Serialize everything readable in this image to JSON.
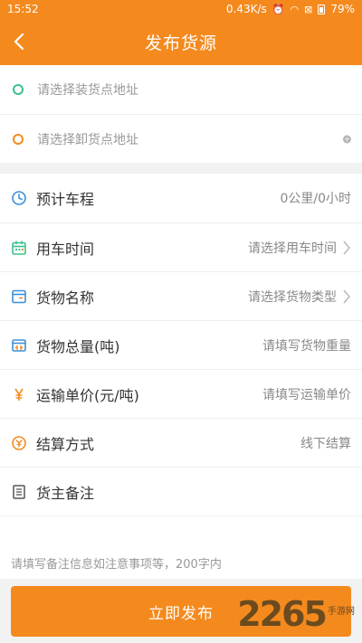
{
  "status_bar": {
    "time": "15:52",
    "speed": "0.43K/s",
    "battery": "79%"
  },
  "header": {
    "title": "发布货源"
  },
  "addresses": {
    "load_placeholder": "请选择装货点地址",
    "unload_placeholder": "请选择卸货点地址"
  },
  "form": {
    "rows": [
      {
        "label": "预计车程",
        "value": "0公里/0小时"
      },
      {
        "label": "用车时间",
        "value": "请选择用车时间"
      },
      {
        "label": "货物名称",
        "value": "请选择货物类型"
      },
      {
        "label": "货物总量(吨)",
        "value": "请填写货物重量"
      },
      {
        "label": "运输单价(元/吨)",
        "value": "请填写运输单价"
      },
      {
        "label": "结算方式",
        "value": "线下结算"
      },
      {
        "label": "货主备注",
        "value": ""
      }
    ],
    "remark_placeholder": "请填写备注信息如注意事项等，200字内"
  },
  "publish_button": "立即发布",
  "watermark": {
    "number": "2265",
    "suffix": "手游网"
  },
  "colors": {
    "accent": "#f48a1e",
    "load_dot": "#3cc18c",
    "icon_blue": "#3b8fd8"
  }
}
